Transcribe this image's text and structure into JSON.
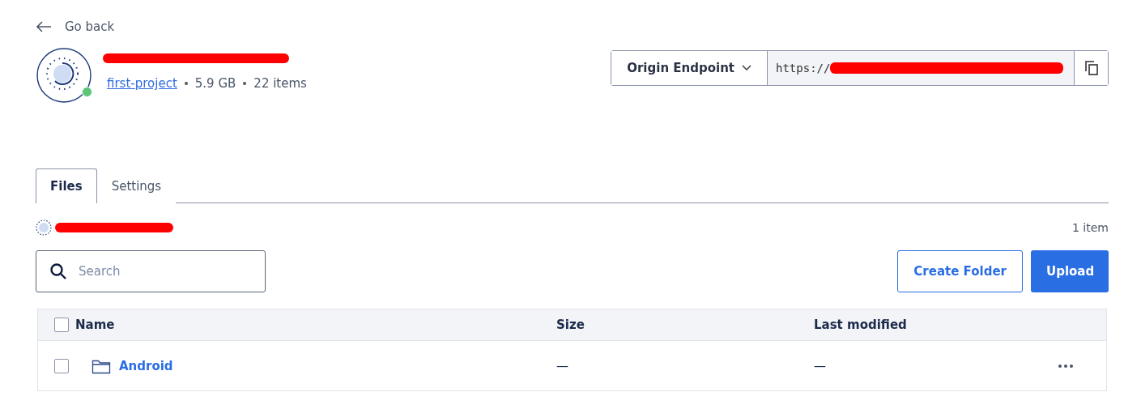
{
  "back_link": {
    "label": "Go back"
  },
  "bucket": {
    "online": true,
    "project": "first-project",
    "size": "5.9 GB",
    "items": "22 items"
  },
  "endpoint": {
    "label": "Origin Endpoint",
    "url_prefix": "https://"
  },
  "tabs": [
    {
      "label": "Files",
      "selected": true
    },
    {
      "label": "Settings",
      "selected": false
    }
  ],
  "item_count": "1 item",
  "search": {
    "placeholder": "Search"
  },
  "buttons": [
    {
      "label": "Create Folder",
      "kind": "outline"
    },
    {
      "label": "Upload",
      "kind": "primary"
    }
  ],
  "table": {
    "columns": [
      "Name",
      "Size",
      "Last modified"
    ],
    "header_checked": false,
    "rows": [
      {
        "name": "Android",
        "kind": "folder",
        "size": "—",
        "modified": "—",
        "checked": false
      }
    ]
  }
}
